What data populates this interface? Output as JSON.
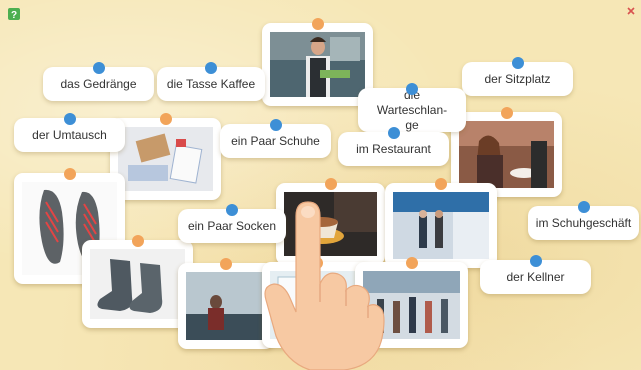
{
  "words": [
    {
      "id": "gedraenge",
      "label": "das Gedränge"
    },
    {
      "id": "kaffee",
      "label": "die Tasse Kaffee"
    },
    {
      "id": "sitzplatz",
      "label": "der Sitzplatz"
    },
    {
      "id": "warteschlange",
      "label": "die Warteschlan-ge"
    },
    {
      "id": "umtausch",
      "label": "der Umtausch"
    },
    {
      "id": "schuhe",
      "label": "ein Paar Schuhe"
    },
    {
      "id": "restaurant",
      "label": "im Restaurant"
    },
    {
      "id": "socken",
      "label": "ein Paar Socken"
    },
    {
      "id": "schuhgeschaeft",
      "label": "im Schuhgeschäft"
    },
    {
      "id": "kellner",
      "label": "der Kellner"
    }
  ],
  "photos": [
    {
      "id": "waiter",
      "icon": "waiter-photo"
    },
    {
      "id": "exchange",
      "icon": "package-exchange-photo"
    },
    {
      "id": "restaurant-woman",
      "icon": "woman-restaurant-photo"
    },
    {
      "id": "shoes",
      "icon": "shoes-photo"
    },
    {
      "id": "coffee",
      "icon": "coffee-cup-photo"
    },
    {
      "id": "shopping-mall",
      "icon": "shopping-mall-photo"
    },
    {
      "id": "socks",
      "icon": "socks-photo"
    },
    {
      "id": "waiting-seat",
      "icon": "waiting-seat-photo"
    },
    {
      "id": "queue",
      "icon": "queue-photo"
    },
    {
      "id": "crowd",
      "icon": "crowd-photo"
    }
  ],
  "colors": {
    "background": "#f6e7b6",
    "pin_word": "#3d8fd6",
    "pin_photo": "#f2a45a",
    "hand": "#f7c9a3"
  }
}
